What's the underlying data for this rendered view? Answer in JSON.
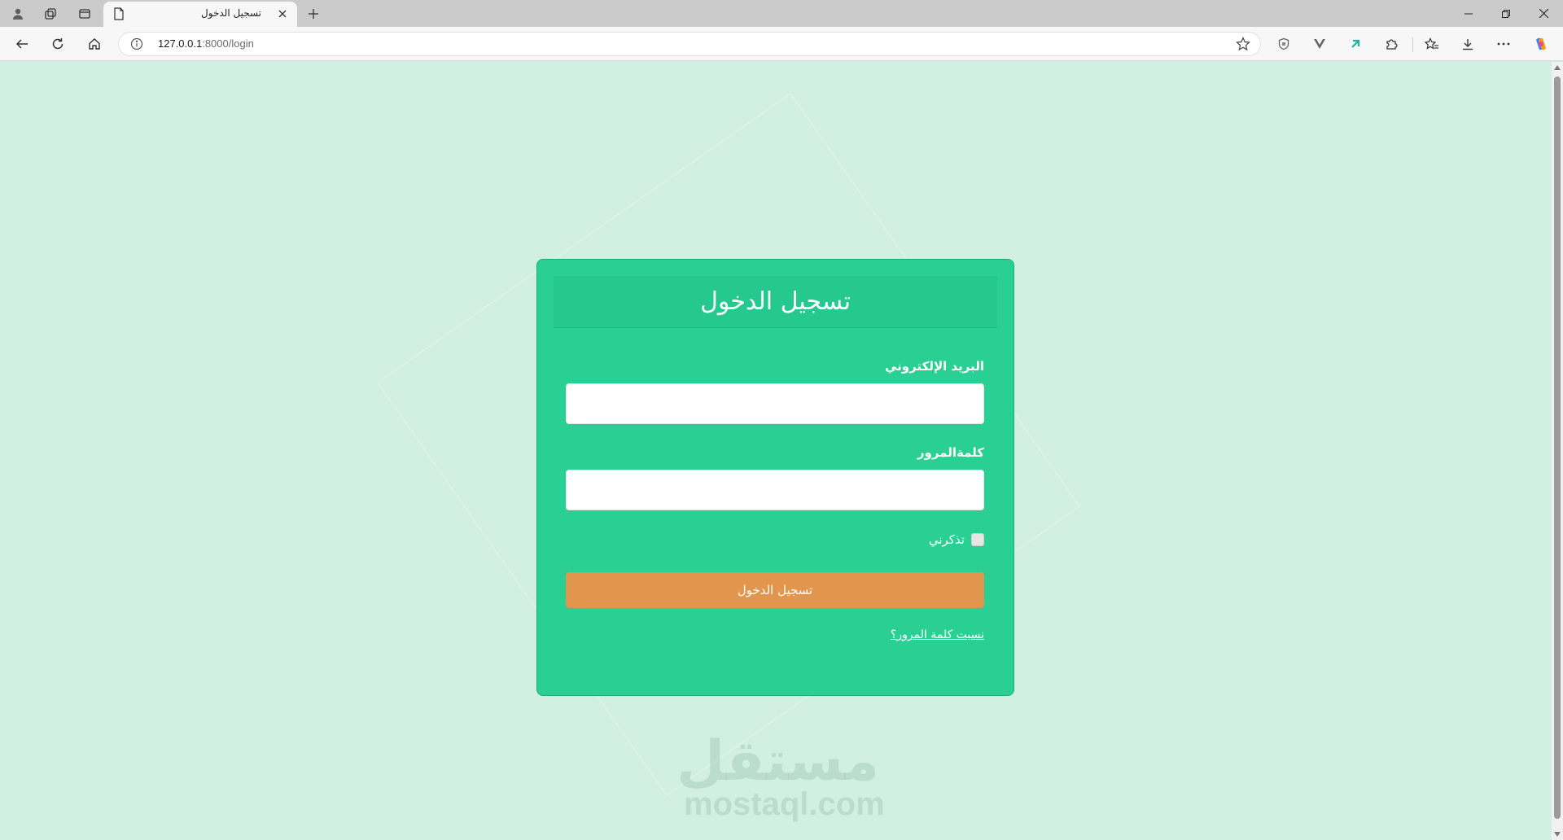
{
  "browser": {
    "tab_title": "تسجيل الدخول",
    "url_host": "127.0.0.1",
    "url_rest": ":8000/login"
  },
  "login": {
    "heading": "تسجيل الدخول",
    "email_label": "البريد الإلكتروني",
    "email_value": "",
    "password_label": "كلمةالمرور",
    "password_value": "",
    "remember_label": "تذكرني",
    "remember_checked": false,
    "submit_label": "تسجيل الدخول",
    "forgot_link": "نسيت كلمة المرور؟"
  },
  "watermark": {
    "arabic": "مستقل",
    "latin": "mostaql.com"
  },
  "colors": {
    "page_bg": "#d2efe3",
    "card_bg": "#2ad093",
    "button_bg": "#e2954c"
  }
}
